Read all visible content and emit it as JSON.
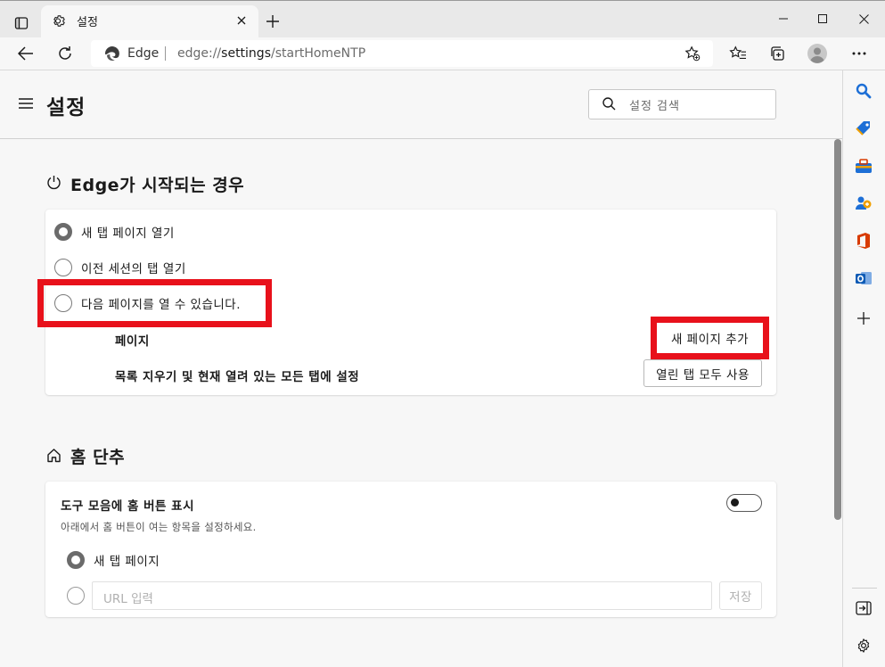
{
  "browser": {
    "tab_title": "설정",
    "address_site": "Edge",
    "address_url_prefix": "edge://",
    "address_url_path": "settings",
    "address_url_rest": "/startHomeNTP"
  },
  "settings": {
    "title": "설정",
    "search_placeholder": "설정 검색",
    "startup": {
      "title": "Edge가 시작되는 경우",
      "options": [
        {
          "label": "새 탭 페이지 열기",
          "selected": true
        },
        {
          "label": "이전 세션의 탭 열기",
          "selected": false
        },
        {
          "label": "다음 페이지를 열 수 있습니다.",
          "selected": false
        }
      ],
      "pages_label": "페이지",
      "add_page_button": "새 페이지 추가",
      "clear_label": "목록 지우기 및 현재 열려 있는 모든 탭에 설정",
      "use_open_tabs_button": "열린 탭 모두 사용"
    },
    "home": {
      "title": "홈 단추",
      "toolbar_label": "도구 모음에 홈 버튼 표시",
      "toolbar_toggle_on": false,
      "description": "아래에서 홈 버튼이 여는 항목을 설정하세요.",
      "options": [
        {
          "label": "새 탭 페이지",
          "selected": true
        }
      ],
      "url_placeholder": "URL 입력",
      "save_button": "저장"
    }
  },
  "colors": {
    "highlight_box": "#e8111b",
    "accent": "#0f6cbd"
  }
}
